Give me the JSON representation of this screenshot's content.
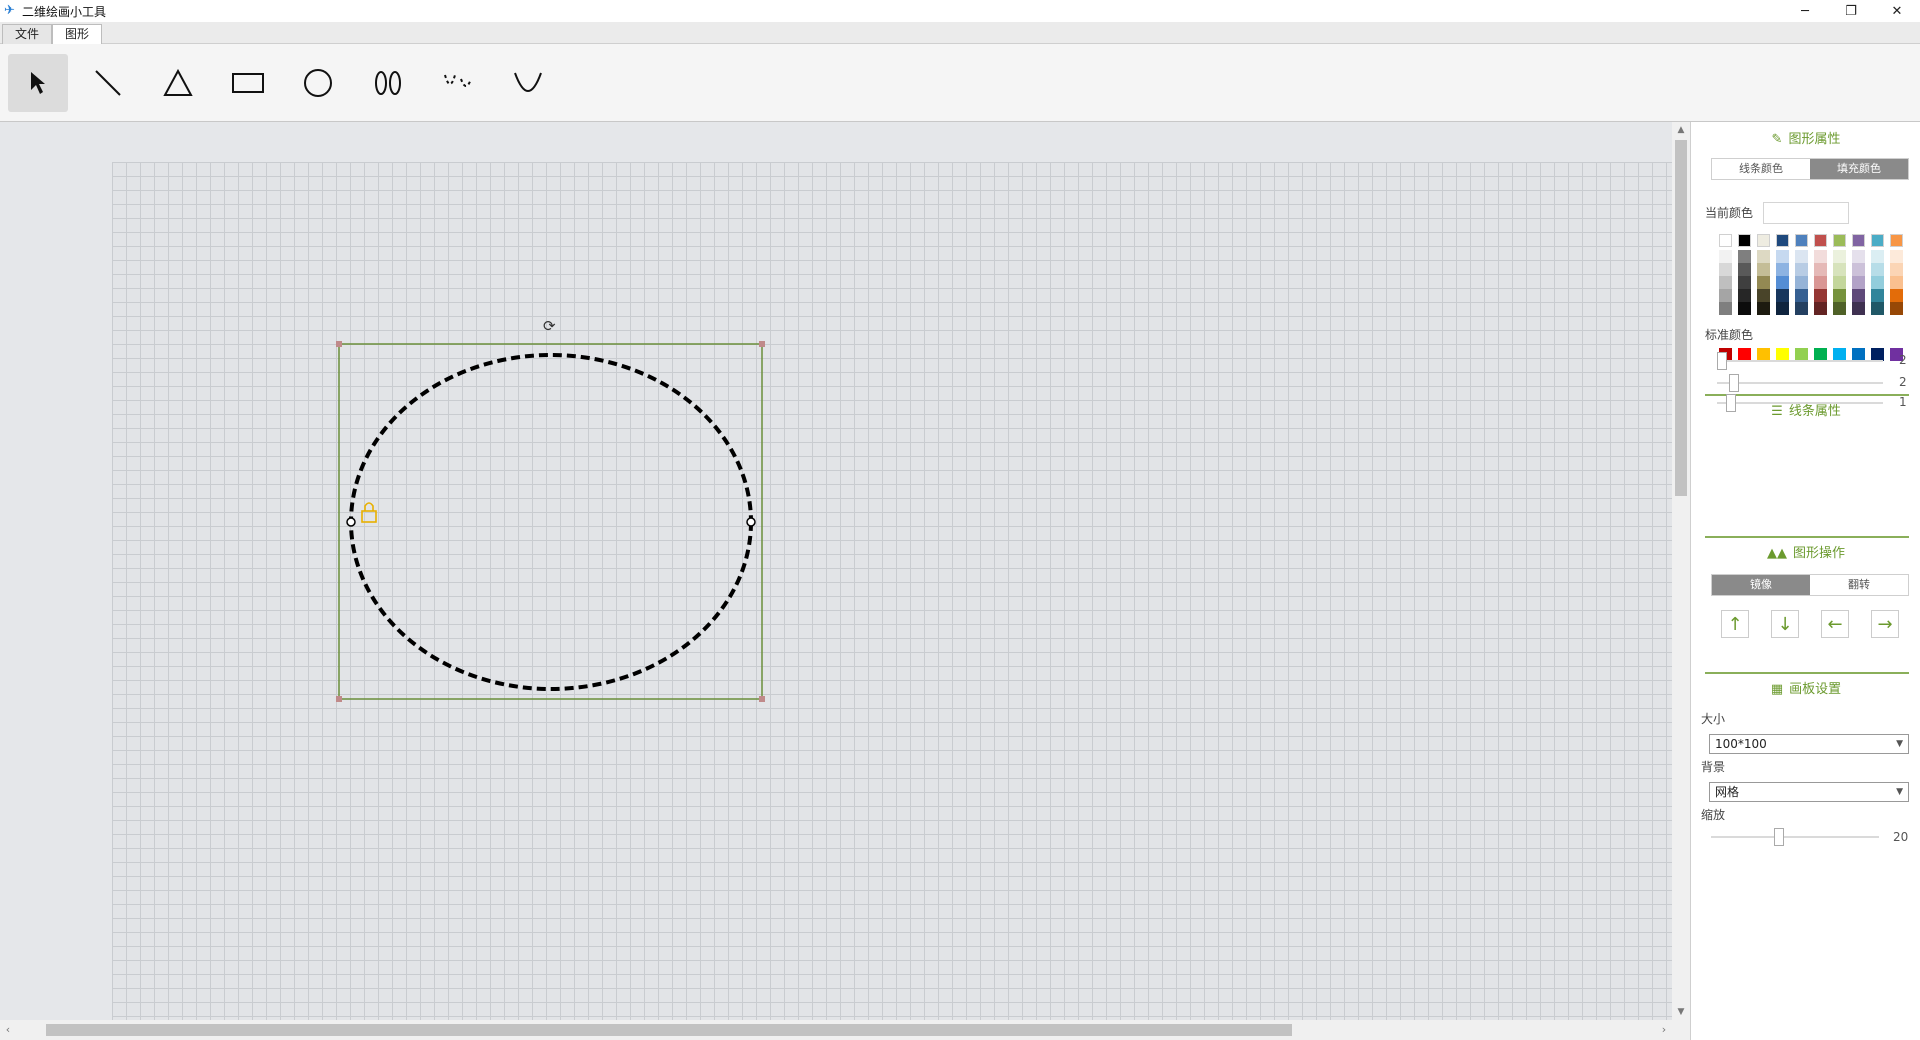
{
  "window": {
    "title": "二维绘画小工具",
    "controls": {
      "minimize": "─",
      "restore": "❐",
      "close": "✕"
    }
  },
  "menu": {
    "tabs": [
      {
        "label": "文件",
        "active": false
      },
      {
        "label": "图形",
        "active": true
      }
    ]
  },
  "toolbar": {
    "tools": [
      "select-arrow-icon",
      "line-icon",
      "triangle-icon",
      "rectangle-icon",
      "circle-icon",
      "ellipse-pair-icon",
      "curve-icon",
      "arc-icon"
    ],
    "active_tool": "select-arrow-icon"
  },
  "canvas": {
    "shape": "ellipse",
    "stroke_color": "#000000",
    "stroke_style": "dashed",
    "selection_color": "#6b8e3a",
    "lock_color": "#e8b000",
    "rotate_handle": "⟳"
  },
  "panel": {
    "shape_props": {
      "title": "图形属性",
      "tabs": [
        {
          "label": "线条颜色",
          "active": false
        },
        {
          "label": "填充颜色",
          "active": true
        }
      ],
      "current_color_label": "当前颜色",
      "standard_colors_label": "标准颜色",
      "theme_top": [
        "#ffffff",
        "#000000",
        "#eeece1",
        "#1f497d",
        "#4f81bd",
        "#c0504d",
        "#9bbb59",
        "#8064a2",
        "#4bacc6",
        "#f79646"
      ],
      "theme_shades": [
        [
          "#f2f2f2",
          "#d8d8d8",
          "#bfbfbf",
          "#a5a5a5",
          "#7f7f7f"
        ],
        [
          "#7f7f7f",
          "#595959",
          "#3f3f3f",
          "#262626",
          "#0c0c0c"
        ],
        [
          "#ddd9c3",
          "#c4bd97",
          "#938953",
          "#494429",
          "#1d1b10"
        ],
        [
          "#c6d9f0",
          "#8db3e2",
          "#548dd4",
          "#17365d",
          "#0f243e"
        ],
        [
          "#dbe5f1",
          "#b8cce4",
          "#95b3d7",
          "#366092",
          "#244061"
        ],
        [
          "#f2dcdb",
          "#e5b9b7",
          "#d99694",
          "#953734",
          "#632423"
        ],
        [
          "#ebf1dd",
          "#d7e3bc",
          "#c3d69b",
          "#76923c",
          "#4f6128"
        ],
        [
          "#e5e0ec",
          "#ccc1d9",
          "#b2a2c7",
          "#5f497a",
          "#3f3151"
        ],
        [
          "#dbeef3",
          "#b7dde8",
          "#92cddc",
          "#31859b",
          "#205867"
        ],
        [
          "#fdeada",
          "#fbd5b5",
          "#fac08f",
          "#e36c09",
          "#974806"
        ]
      ],
      "standard": [
        "#c00000",
        "#ff0000",
        "#ffc000",
        "#ffff00",
        "#92d050",
        "#00b050",
        "#00b0f0",
        "#0070c0",
        "#002060",
        "#7030a0"
      ]
    },
    "line_props": {
      "title": "线条属性",
      "sliders": [
        {
          "value": "2",
          "level": 0.0
        },
        {
          "value": "2",
          "level": 0.08
        },
        {
          "value": "1",
          "level": 0.06
        }
      ]
    },
    "shape_ops": {
      "title": "图形操作",
      "tabs": [
        {
          "label": "镜像",
          "active": true
        },
        {
          "label": "翻转",
          "active": false
        }
      ],
      "buttons": [
        "↑",
        "↓",
        "←",
        "→"
      ]
    },
    "board": {
      "title": "画板设置",
      "size_label": "大小",
      "size_value": "100*100",
      "bg_label": "背景",
      "bg_value": "网格",
      "zoom_label": "缩放",
      "zoom_value": "20",
      "zoom_level": 0.4
    }
  }
}
